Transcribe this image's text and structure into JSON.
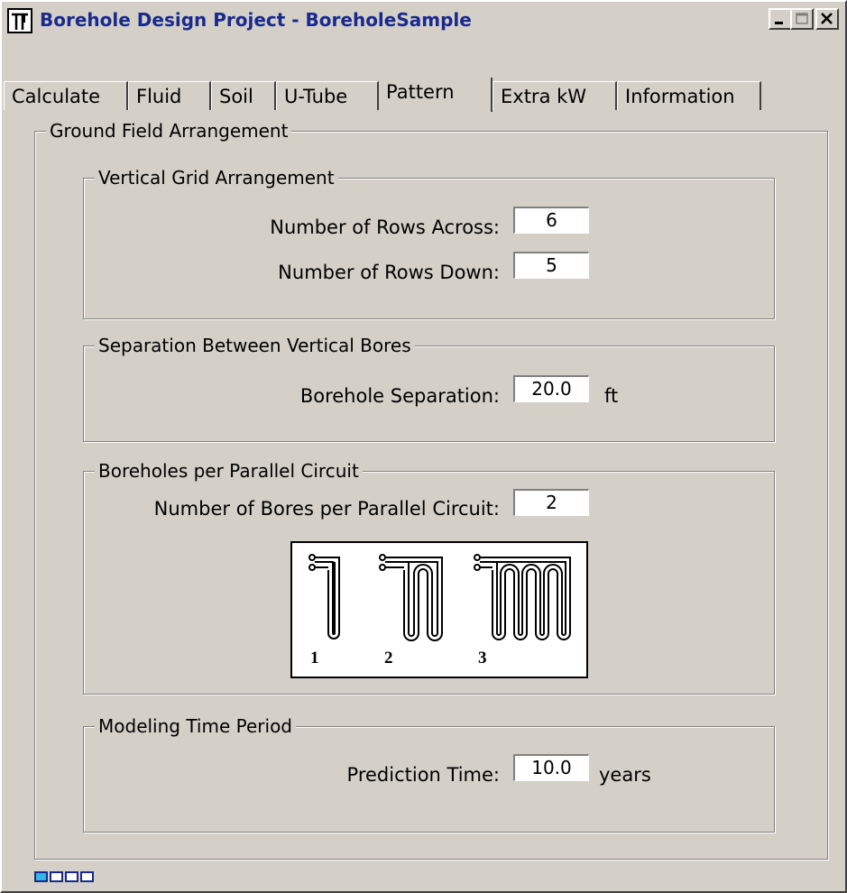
{
  "window": {
    "title": "Borehole Design Project - BoreholeSample",
    "minimize_icon": "minimize-icon",
    "maximize_icon": "maximize-icon",
    "close_icon": "close-icon"
  },
  "tabs": [
    {
      "label": "Calculate",
      "active": false
    },
    {
      "label": "Fluid",
      "active": false
    },
    {
      "label": "Soil",
      "active": false
    },
    {
      "label": "U-Tube",
      "active": false
    },
    {
      "label": "Pattern",
      "active": true
    },
    {
      "label": "Extra kW",
      "active": false
    },
    {
      "label": "Information",
      "active": false
    }
  ],
  "ground_field": {
    "title": "Ground Field Arrangement",
    "vertical_grid": {
      "title": "Vertical Grid Arrangement",
      "rows_across_label": "Number of Rows Across:",
      "rows_across_value": "6",
      "rows_down_label": "Number of Rows Down:",
      "rows_down_value": "5"
    },
    "separation": {
      "title": "Separation Between Vertical Bores",
      "label": "Borehole Separation:",
      "value": "20.0",
      "unit": "ft"
    },
    "parallel": {
      "title": "Boreholes per Parallel Circuit",
      "label": "Number of Bores per Parallel Circuit:",
      "value": "2",
      "diagram_labels": [
        "1",
        "2",
        "3"
      ]
    },
    "modeling": {
      "title": "Modeling Time Period",
      "label": "Prediction Time:",
      "value": "10.0",
      "unit": "years"
    }
  },
  "colors": {
    "title_text": "#1a2a8c",
    "face": "#d4d0c8",
    "status_active": "#33b5e5"
  }
}
